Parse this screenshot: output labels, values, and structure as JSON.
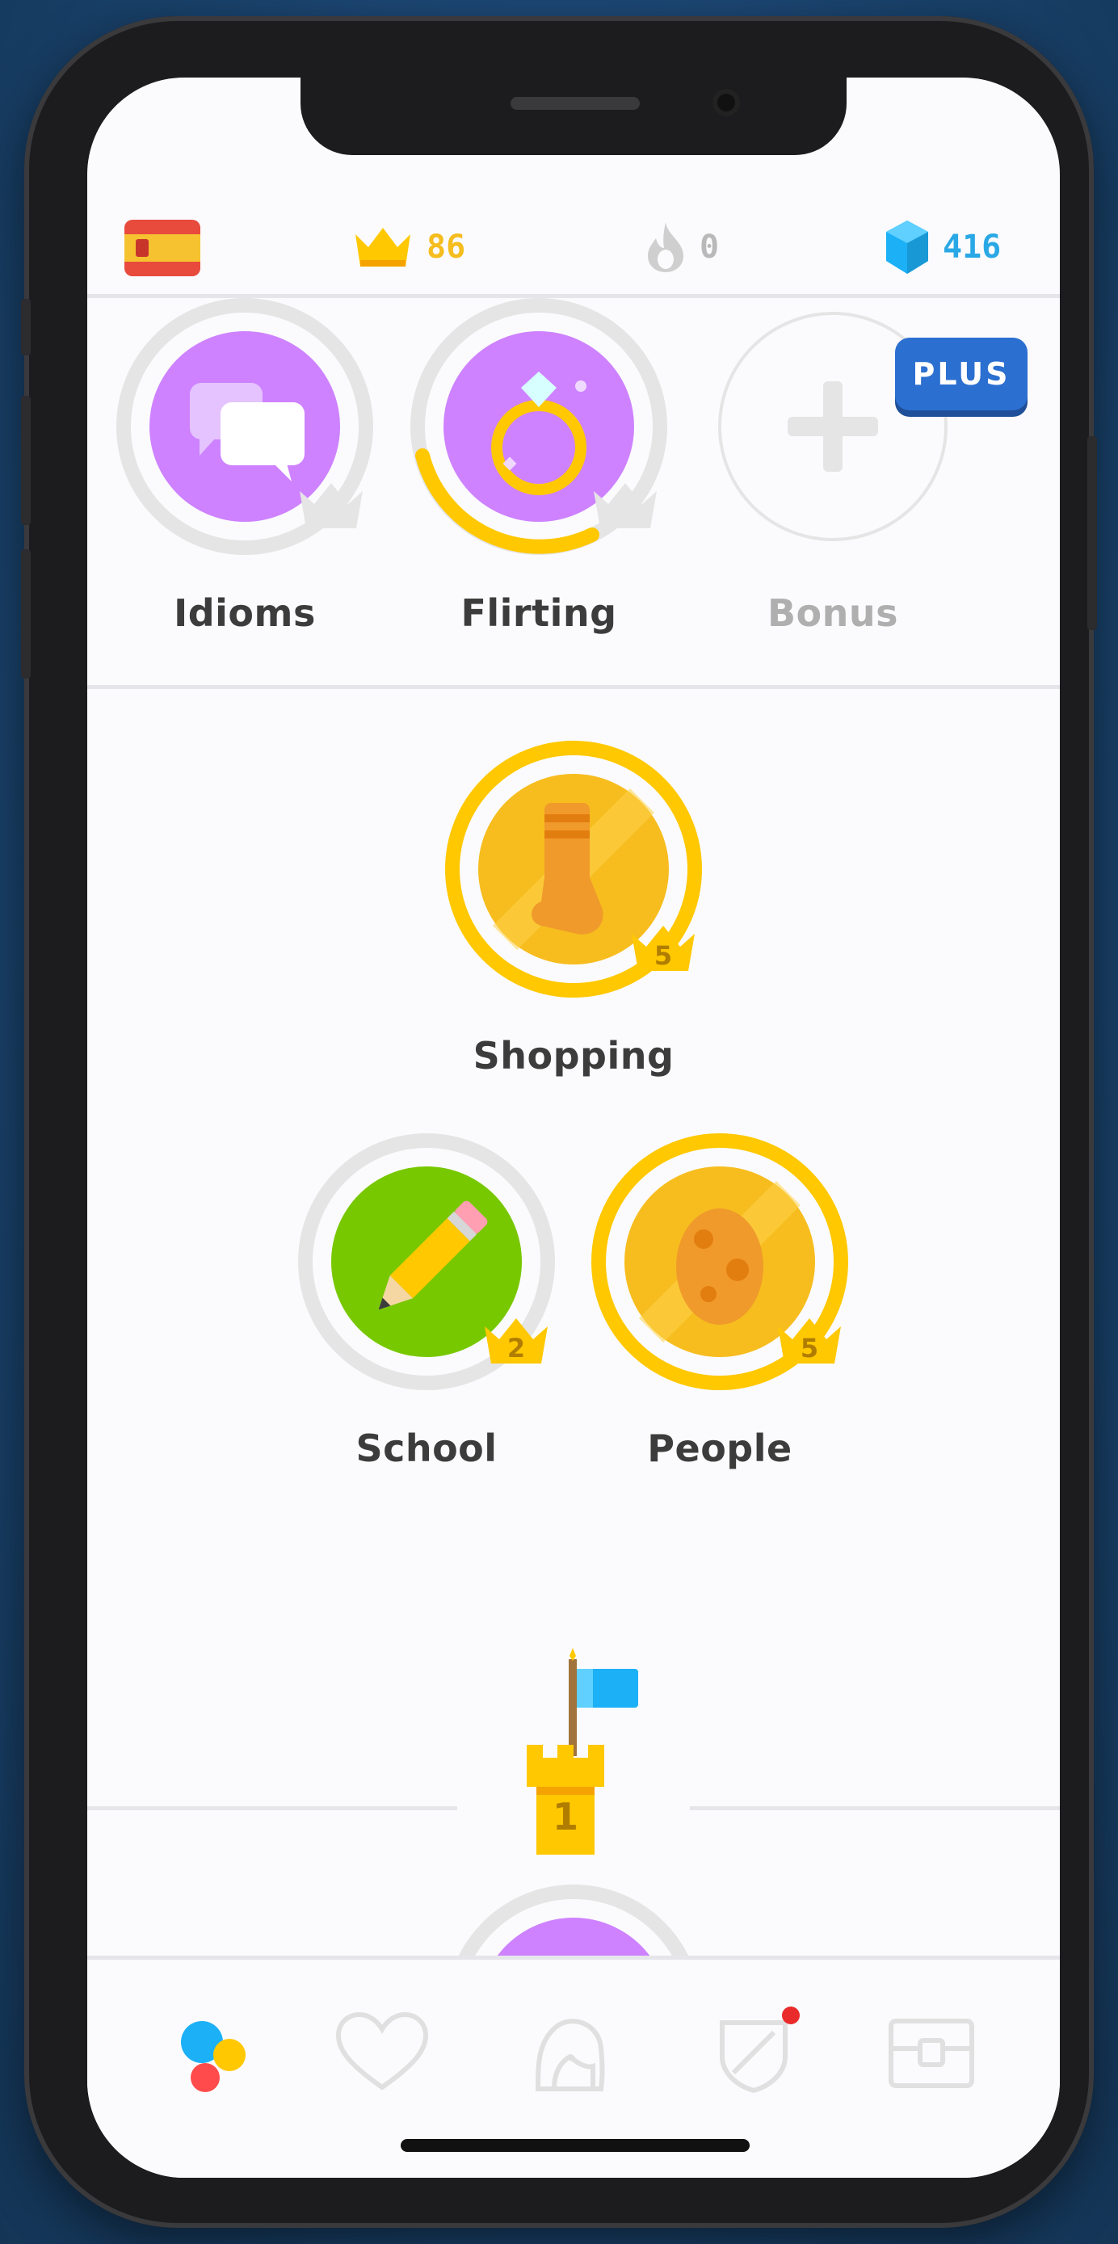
{
  "status": {
    "language_flag": "spanish-flag",
    "crowns": "86",
    "streak": "0",
    "gems": "416"
  },
  "skills_row1": [
    {
      "label": "Idioms",
      "icon": "chat-bubbles-icon",
      "color": "#ce82ff"
    },
    {
      "label": "Flirting",
      "icon": "ring-icon",
      "color": "#ce82ff",
      "progress": 0.35
    },
    {
      "label": "Bonus",
      "icon": "plus-icon",
      "badge": "PLUS"
    }
  ],
  "skills": [
    {
      "label": "Shopping",
      "icon": "sock-icon",
      "crown_level": "5",
      "color": "#ffc800"
    },
    {
      "label": "School",
      "icon": "pencil-icon",
      "crown_level": "2",
      "color": "#78c800"
    },
    {
      "label": "People",
      "icon": "egg-icon",
      "crown_level": "5",
      "color": "#ffc800"
    }
  ],
  "checkpoint": {
    "number": "1",
    "icon": "castle-checkpoint-icon"
  },
  "nav": [
    {
      "name": "learn",
      "icon": "learn-dots-icon"
    },
    {
      "name": "stories",
      "icon": "heart-icon"
    },
    {
      "name": "profile",
      "icon": "profile-icon"
    },
    {
      "name": "leaderboards",
      "icon": "shield-icon",
      "notification": true
    },
    {
      "name": "shop",
      "icon": "chest-icon"
    }
  ]
}
